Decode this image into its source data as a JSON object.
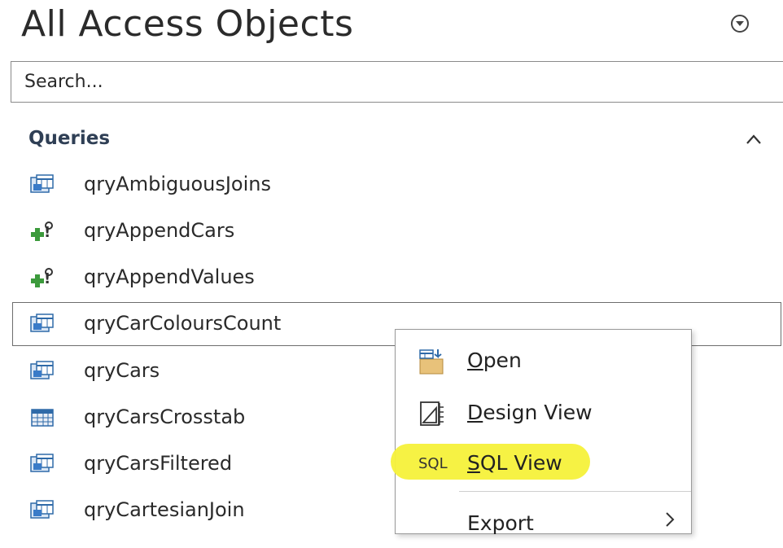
{
  "pane": {
    "title": "All Access Objects",
    "search_placeholder": "Search..."
  },
  "group": {
    "label": "Queries",
    "items": [
      {
        "label": "qryAmbiguousJoins",
        "icon": "select-query-icon",
        "selected": false
      },
      {
        "label": "qryAppendCars",
        "icon": "append-query-icon",
        "selected": false
      },
      {
        "label": "qryAppendValues",
        "icon": "append-query-icon",
        "selected": false
      },
      {
        "label": "qryCarColoursCount",
        "icon": "select-query-icon",
        "selected": true
      },
      {
        "label": "qryCars",
        "icon": "select-query-icon",
        "selected": false
      },
      {
        "label": "qryCarsCrosstab",
        "icon": "crosstab-query-icon",
        "selected": false
      },
      {
        "label": "qryCarsFiltered",
        "icon": "select-query-icon",
        "selected": false
      },
      {
        "label": "qryCartesianJoin",
        "icon": "select-query-icon",
        "selected": false
      }
    ]
  },
  "context_menu": {
    "open": {
      "label": "Open",
      "accel": "O",
      "rest": "pen",
      "icon": "open-icon"
    },
    "design_view": {
      "label": "Design View",
      "accel": "D",
      "rest": "esign View",
      "icon": "design-view-icon"
    },
    "sql_view": {
      "label": "SQL View",
      "accel": "S",
      "rest": "QL View",
      "icon_text": "SQL",
      "highlight_color": "#f6f13a"
    },
    "export": {
      "label": "Export",
      "icon": "chevron-right-icon"
    }
  },
  "colors": {
    "group_header": "#2f3f55",
    "selection_border": "#6d6d6d"
  }
}
